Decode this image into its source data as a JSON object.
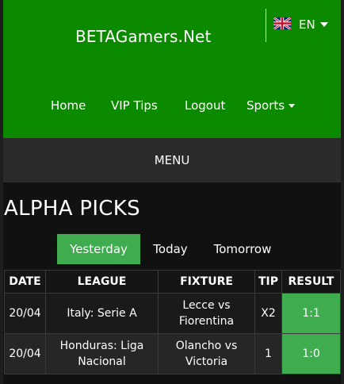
{
  "header": {
    "brand": "BETAGamers.Net",
    "language": {
      "code": "EN",
      "flag": "uk-flag-icon"
    },
    "nav": [
      {
        "label": "Home"
      },
      {
        "label": "VIP Tips"
      },
      {
        "label": "Logout"
      },
      {
        "label": "Sports",
        "dropdown": true
      }
    ]
  },
  "menu": {
    "label": "MENU"
  },
  "page": {
    "title": "ALPHA PICKS",
    "tabs": [
      {
        "label": "Yesterday",
        "active": true
      },
      {
        "label": "Today",
        "active": false
      },
      {
        "label": "Tomorrow",
        "active": false
      }
    ]
  },
  "table": {
    "columns": [
      "DATE",
      "LEAGUE",
      "FIXTURE",
      "TIP",
      "RESULT"
    ],
    "rows": [
      {
        "date": "20/04",
        "league": "Italy: Serie A",
        "fixture": "Lecce vs Fiorentina",
        "tip": "X2",
        "result": "1:1"
      },
      {
        "date": "20/04",
        "league": "Honduras: Liga Nacional",
        "fixture": "Olancho vs Victoria",
        "tip": "1",
        "result": "1:0"
      }
    ]
  },
  "colors": {
    "header_green": "#0b8a00",
    "accent_green": "#3fad4f",
    "background": "#111111"
  }
}
